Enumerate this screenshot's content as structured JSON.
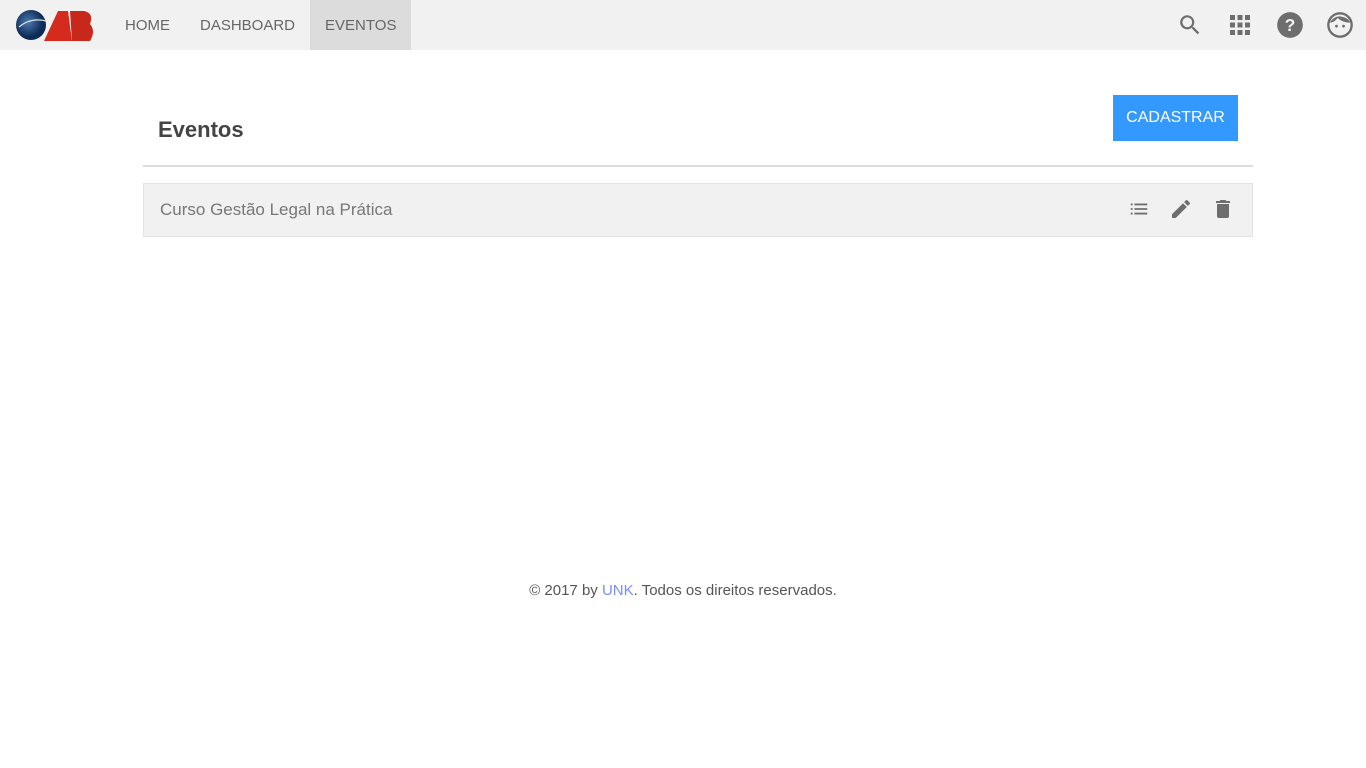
{
  "nav": {
    "logo_text": "OAB",
    "items": [
      {
        "label": "HOME"
      },
      {
        "label": "DASHBOARD"
      },
      {
        "label": "EVENTOS",
        "active": true
      }
    ],
    "icons": [
      "search-icon",
      "apps-grid-icon",
      "help-icon",
      "user-face-icon"
    ]
  },
  "page": {
    "title": "Eventos",
    "register_label": "CADASTRAR"
  },
  "events": [
    {
      "name": "Curso Gestão Legal na Prática"
    }
  ],
  "footer": {
    "prefix": "© 2017 by ",
    "link": "UNK",
    "suffix": ". Todos os direitos reservados."
  },
  "colors": {
    "accent": "#3399ff",
    "navbar": "#f1f1f1",
    "icon": "#6e6e6e",
    "logo_red": "#d52b1e"
  }
}
